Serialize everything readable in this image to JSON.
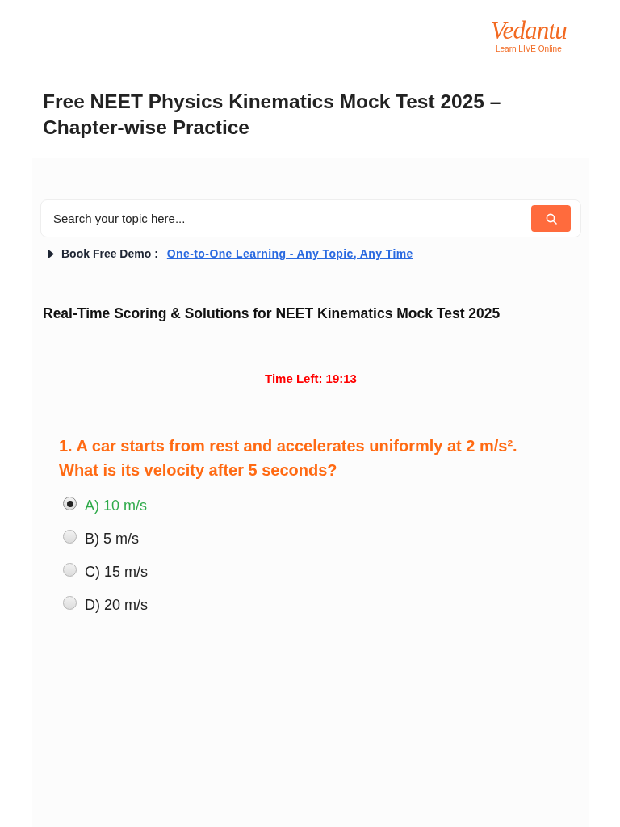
{
  "logo": {
    "wordmark": "Vedantu",
    "tagline": "Learn LIVE Online"
  },
  "title": "Free NEET Physics Kinematics Mock Test 2025 – Chapter-wise Practice",
  "search": {
    "placeholder": "Search your topic here..."
  },
  "demo": {
    "label": "Book Free Demo :",
    "link": "One-to-One Learning - Any Topic, Any Time"
  },
  "section_heading": "Real-Time Scoring & Solutions for NEET Kinematics Mock Test 2025",
  "timer": "Time Left: 19:13",
  "question": {
    "text": "1. A car starts from rest and accelerates uniformly at 2 m/s². What is its velocity after 5 seconds?",
    "options": [
      {
        "label": "A) 10 m/s",
        "selected": true,
        "correct": true
      },
      {
        "label": "B) 5 m/s",
        "selected": false,
        "correct": false
      },
      {
        "label": "C) 15 m/s",
        "selected": false,
        "correct": false
      },
      {
        "label": "D) 20 m/s",
        "selected": false,
        "correct": false
      }
    ]
  }
}
